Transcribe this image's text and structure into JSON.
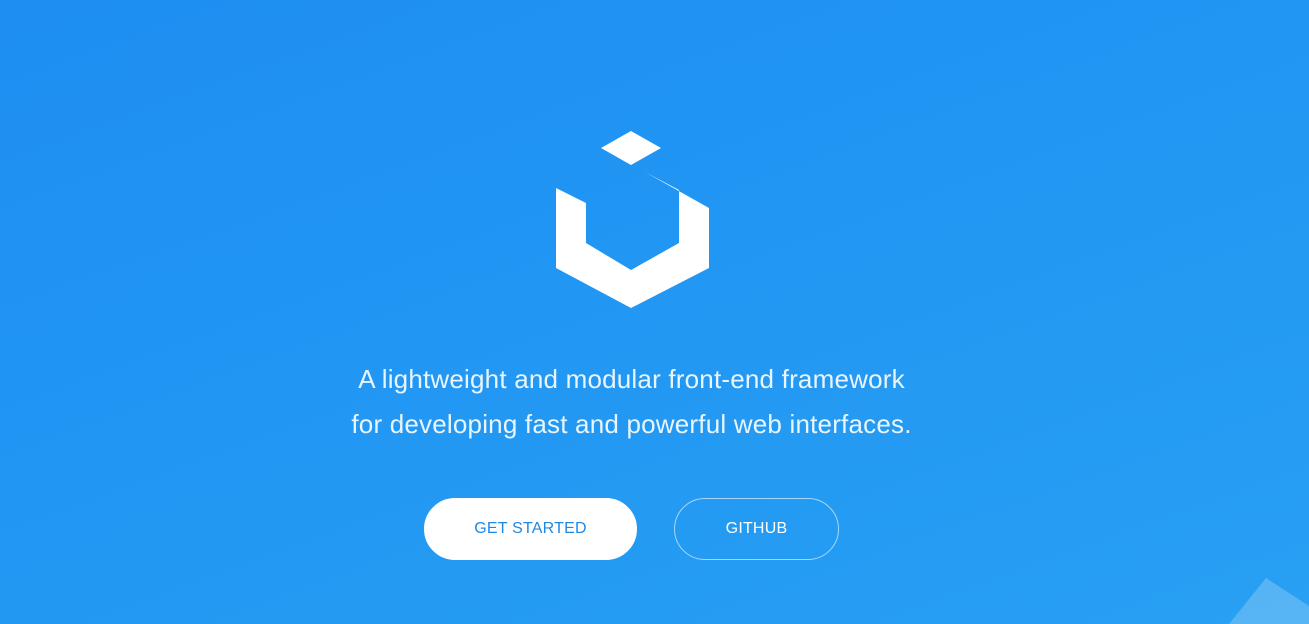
{
  "hero": {
    "logo_icon": "uikit-hexagon-logo-icon",
    "tagline_line1": "A lightweight and modular front-end framework",
    "tagline_line2": "for developing fast and powerful web interfaces.",
    "primary_button_label": "GET STARTED",
    "secondary_button_label": "GITHUB"
  },
  "colors": {
    "background": "#2196f3",
    "primary_button_text": "#1e88e5",
    "white": "#ffffff"
  }
}
